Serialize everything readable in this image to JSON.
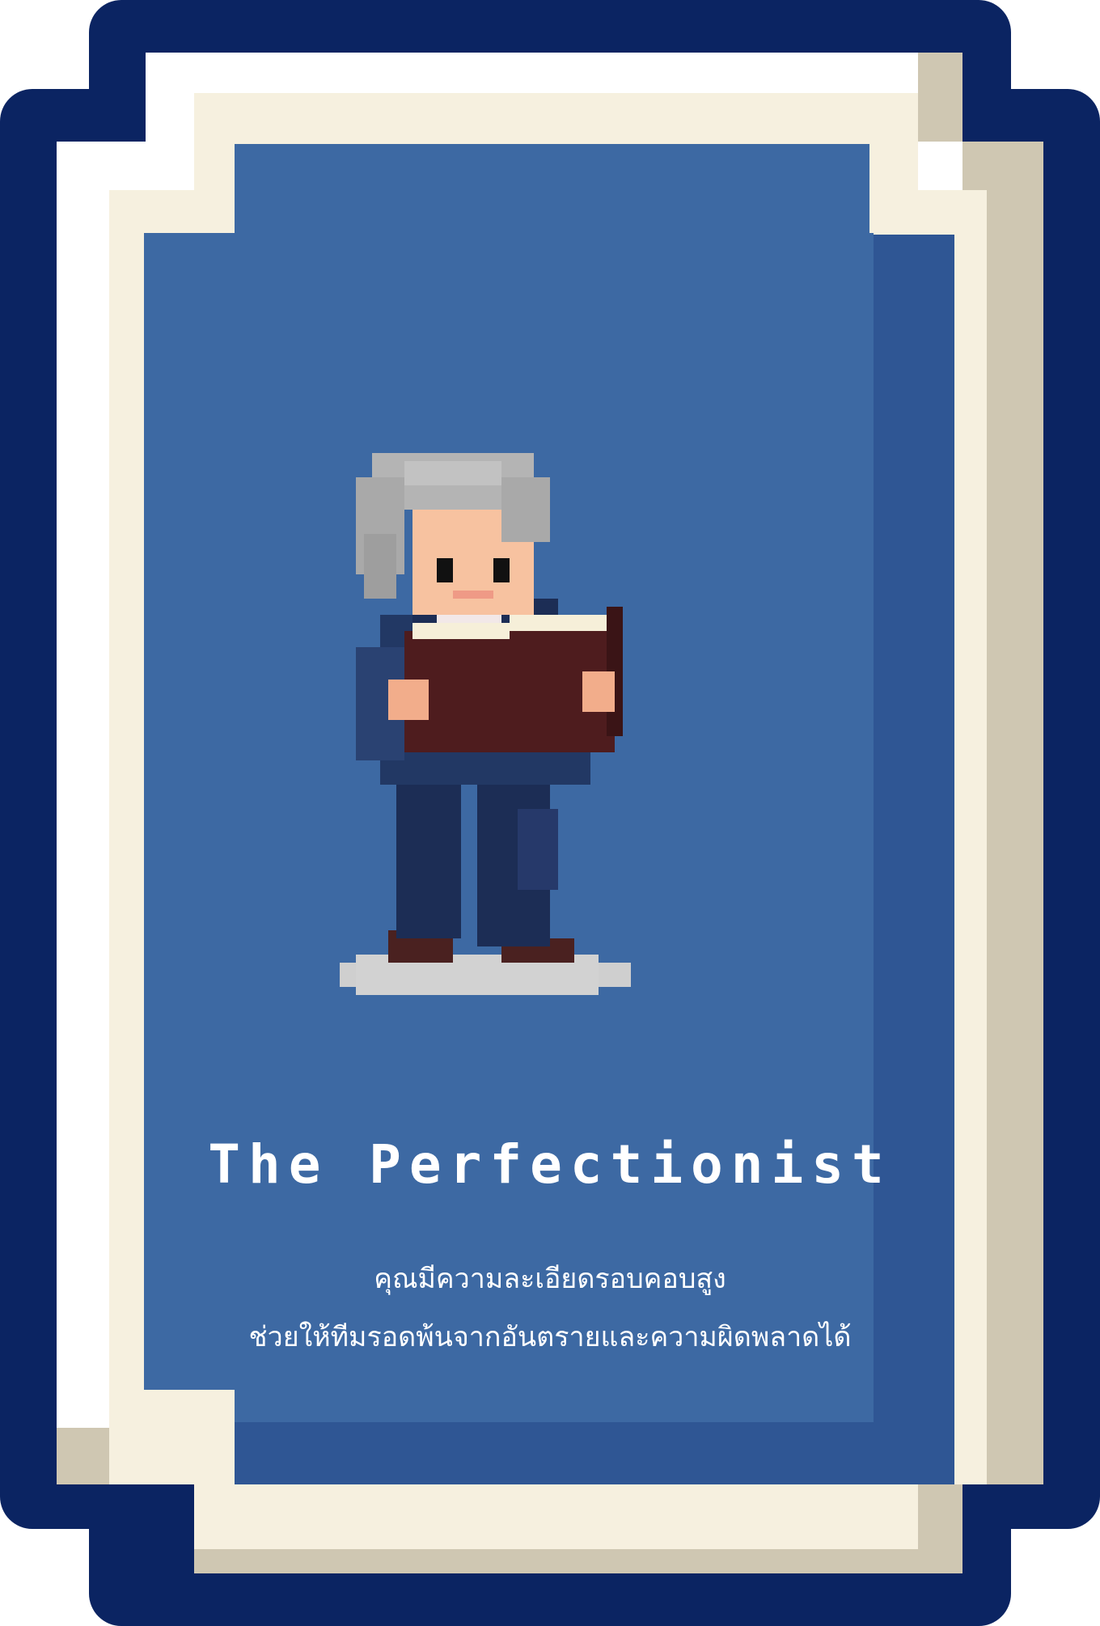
{
  "card": {
    "title": "The Perfectionist",
    "description_lines": [
      "คุณมีความละเอียดรอบคอบสูง",
      "ช่วยให้ทีมรอดพ้นจากอันตรายและความผิดพลาดได้"
    ],
    "character_icon": "scholar-reading-book-icon"
  },
  "colors": {
    "frame_navy": "#0b2462",
    "frame_cream": "#f6f0df",
    "frame_beige": "#cfc7b2",
    "panel_blue": "#3d69a3",
    "text": "#ffffff"
  }
}
